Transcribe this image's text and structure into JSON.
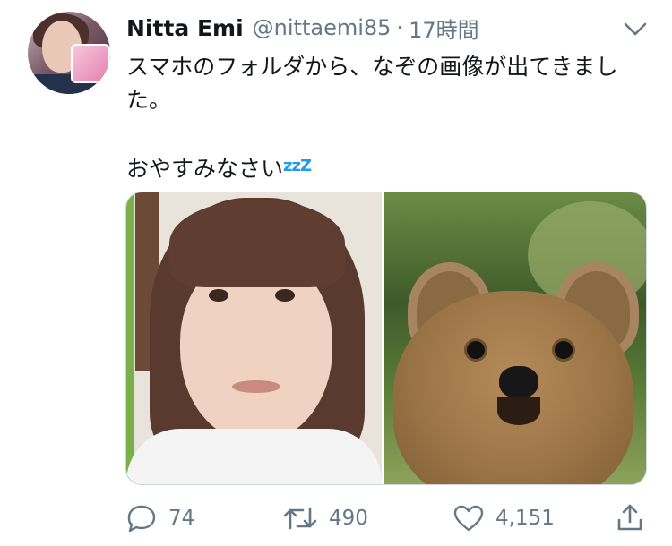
{
  "tweet": {
    "display_name": "Nitta Emi",
    "handle": "@nittaemi85",
    "separator": "·",
    "time": "17時間",
    "text_line1": "スマホのフォルダから、なぞの画像が出てきました。",
    "text_line2": "おやすみなさい",
    "zzz": "zzZ"
  },
  "media": {
    "left_image": "woman-photo",
    "right_image": "quokka-photo"
  },
  "actions": {
    "reply_count": "74",
    "retweet_count": "490",
    "like_count": "4,151"
  },
  "icons": {
    "more": "chevron-down-icon",
    "reply": "reply-icon",
    "retweet": "retweet-icon",
    "like": "heart-icon",
    "share": "share-icon"
  },
  "colors": {
    "text": "#14171a",
    "secondary": "#657786",
    "accent": "#1d9bf0"
  }
}
